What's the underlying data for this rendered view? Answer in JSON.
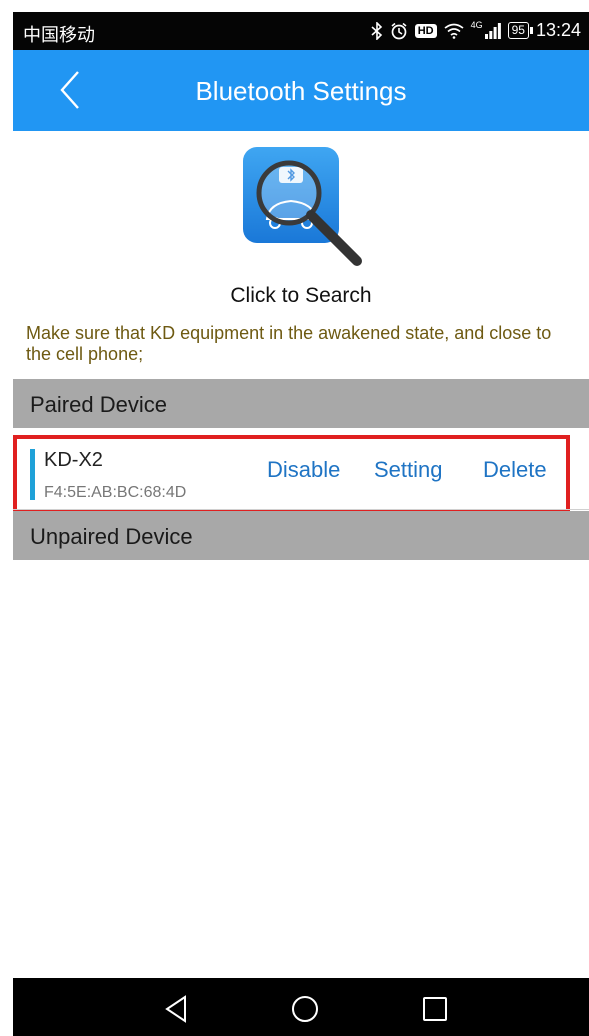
{
  "status_bar": {
    "carrier": "中国移动",
    "network_label": "4G",
    "battery": "95",
    "time": "13:24",
    "icons": [
      "bluetooth-icon",
      "alarm-icon",
      "hd-icon",
      "wifi-icon",
      "signal-icon",
      "battery-icon"
    ],
    "hd_label": "HD"
  },
  "header": {
    "title": "Bluetooth Settings",
    "background": "#2196f3",
    "back_icon": "chevron-left-icon"
  },
  "search": {
    "label": "Click to Search",
    "icon": "bluetooth-car-search-icon"
  },
  "hint": "Make sure that KD equipment in the awakened state, and close to the cell phone;",
  "paired_section": {
    "title": "Paired Device",
    "devices": [
      {
        "name": "KD-X2",
        "mac": "F4:5E:AB:BC:68:4D",
        "actions": {
          "disable": "Disable",
          "setting": "Setting",
          "delete": "Delete"
        }
      }
    ]
  },
  "unpaired_section": {
    "title": "Unpaired Device"
  },
  "colors": {
    "accent": "#2196f3",
    "action_text": "#1f74c4",
    "hint_text": "#6e5a12",
    "section_header": "#a8a8a8",
    "highlight_border": "#e02020",
    "device_bar": "#1fa1d8"
  },
  "nav_bar": {
    "icons": [
      "nav-back-icon",
      "nav-home-icon",
      "nav-recent-icon"
    ]
  }
}
